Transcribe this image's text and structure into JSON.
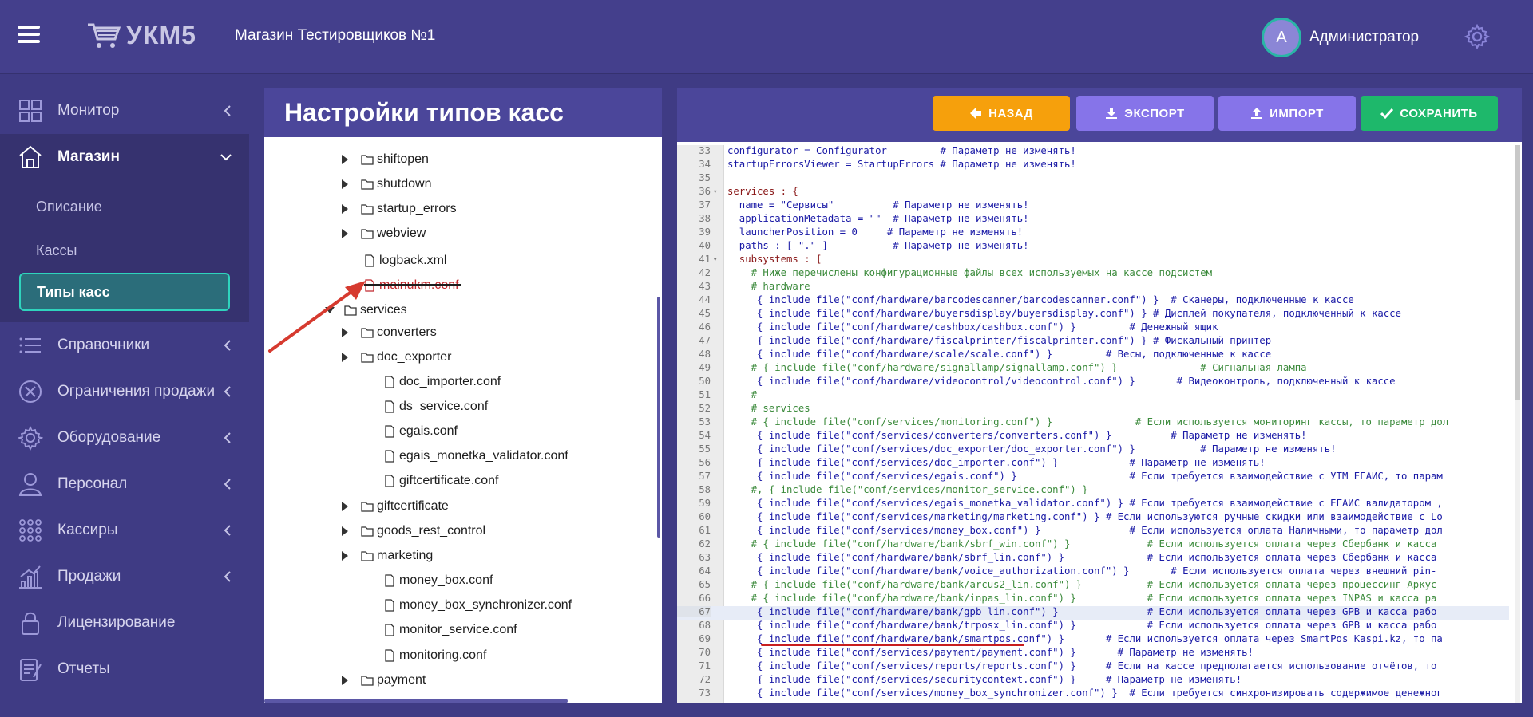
{
  "header": {
    "logo_text": "УКМ5",
    "store_name": "Магазин Тестировщиков №1",
    "user_initial": "А",
    "user_name": "Администратор"
  },
  "sidebar": {
    "items": [
      {
        "label": "Монитор",
        "icon": "grid-icon"
      },
      {
        "label": "Магазин",
        "icon": "store-icon",
        "open": true
      },
      {
        "label": "Справочники",
        "icon": "list-icon"
      },
      {
        "label": "Ограничения продажи",
        "icon": "x-circle-icon"
      },
      {
        "label": "Оборудование",
        "icon": "gear-icon"
      },
      {
        "label": "Персонал",
        "icon": "user-icon"
      },
      {
        "label": "Кассиры",
        "icon": "dots-grid-icon"
      },
      {
        "label": "Продажи",
        "icon": "chart-icon"
      },
      {
        "label": "Лицензирование",
        "icon": "lock-icon"
      },
      {
        "label": "Отчеты",
        "icon": "report-icon"
      }
    ],
    "submenu": [
      {
        "label": "Описание"
      },
      {
        "label": "Кассы"
      },
      {
        "label": "Типы касс",
        "active": true
      }
    ]
  },
  "tree_panel": {
    "title": "Настройки типов касс",
    "rows": [
      {
        "label": "shiftopen",
        "kind": "folder",
        "arrow": true
      },
      {
        "label": "shutdown",
        "kind": "folder",
        "arrow": true
      },
      {
        "label": "startup_errors",
        "kind": "folder",
        "arrow": true
      },
      {
        "label": "webview",
        "kind": "folder",
        "arrow": true
      },
      {
        "label": "logback.xml",
        "kind": "file",
        "arrow": false
      },
      {
        "label": "mainukm.conf",
        "kind": "file",
        "arrow": false,
        "error": true
      },
      {
        "label": "services",
        "kind": "folder",
        "arrow": true,
        "expanded": true
      },
      {
        "label": "converters",
        "kind": "folder",
        "arrow": true
      },
      {
        "label": "doc_exporter",
        "kind": "folder",
        "arrow": true
      },
      {
        "label": "doc_importer.conf",
        "kind": "file",
        "arrow": false
      },
      {
        "label": "ds_service.conf",
        "kind": "file",
        "arrow": false
      },
      {
        "label": "egais.conf",
        "kind": "file",
        "arrow": false
      },
      {
        "label": "egais_monetka_validator.conf",
        "kind": "file",
        "arrow": false
      },
      {
        "label": "giftcertificate.conf",
        "kind": "file",
        "arrow": false
      },
      {
        "label": "giftcertificate",
        "kind": "folder",
        "arrow": true
      },
      {
        "label": "goods_rest_control",
        "kind": "folder",
        "arrow": true
      },
      {
        "label": "marketing",
        "kind": "folder",
        "arrow": true
      },
      {
        "label": "money_box.conf",
        "kind": "file",
        "arrow": false
      },
      {
        "label": "money_box_synchronizer.conf",
        "kind": "file",
        "arrow": false
      },
      {
        "label": "monitor_service.conf",
        "kind": "file",
        "arrow": false
      },
      {
        "label": "monitoring.conf",
        "kind": "file",
        "arrow": false
      },
      {
        "label": "payment",
        "kind": "folder",
        "arrow": true
      }
    ]
  },
  "toolbar": {
    "back_label": "НАЗАД",
    "export_label": "ЭКСПОРТ",
    "import_label": "ИМПОРТ",
    "save_label": "СОХРАНИТЬ"
  },
  "editor": {
    "lines": [
      {
        "n": "33",
        "t": "configurator = Configurator         # Параметр не изменять!"
      },
      {
        "n": "34",
        "t": "startupErrorsViewer = StartupErrors # Параметр не изменять!"
      },
      {
        "n": "35",
        "t": ""
      },
      {
        "n": "36",
        "t": "services : {",
        "fold": true
      },
      {
        "n": "37",
        "t": "  name = \"Сервисы\"          # Параметр не изменять!"
      },
      {
        "n": "38",
        "t": "  applicationMetadata = \"\"  # Параметр не изменять!"
      },
      {
        "n": "39",
        "t": "  launcherPosition = 0     # Параметр не изменять!"
      },
      {
        "n": "40",
        "t": "  paths : [ \".\" ]           # Параметр не изменять!"
      },
      {
        "n": "41",
        "t": "  subsystems : [",
        "fold": true
      },
      {
        "n": "42",
        "t": "    # Ниже перечислены конфигурационные файлы всех используемых на кассе подсистем"
      },
      {
        "n": "43",
        "t": "    # hardware"
      },
      {
        "n": "44",
        "t": "     { include file(\"conf/hardware/barcodescanner/barcodescanner.conf\") }  # Сканеры, подключенные к кассе"
      },
      {
        "n": "45",
        "t": "     { include file(\"conf/hardware/buyersdisplay/buyersdisplay.conf\") } # Дисплей покупателя, подключенный к кассе"
      },
      {
        "n": "46",
        "t": "     { include file(\"conf/hardware/cashbox/cashbox.conf\") }         # Денежный ящик"
      },
      {
        "n": "47",
        "t": "     { include file(\"conf/hardware/fiscalprinter/fiscalprinter.conf\") } # Фискальный принтер"
      },
      {
        "n": "48",
        "t": "     { include file(\"conf/hardware/scale/scale.conf\") }         # Весы, подключенные к кассе"
      },
      {
        "n": "49",
        "t": "    # { include file(\"conf/hardware/signallamp/signallamp.conf\") }              # Сигнальная лампа"
      },
      {
        "n": "50",
        "t": "     { include file(\"conf/hardware/videocontrol/videocontrol.conf\") }       # Видеоконтроль, подключенный к кассе"
      },
      {
        "n": "51",
        "t": "    #"
      },
      {
        "n": "52",
        "t": "    # services"
      },
      {
        "n": "53",
        "t": "    # { include file(\"conf/services/monitoring.conf\") }              # Если используется мониторинг кассы, то параметр дол"
      },
      {
        "n": "54",
        "t": "     { include file(\"conf/services/converters/converters.conf\") }          # Параметр не изменять!"
      },
      {
        "n": "55",
        "t": "     { include file(\"conf/services/doc_exporter/doc_exporter.conf\") }           # Параметр не изменять!"
      },
      {
        "n": "56",
        "t": "     { include file(\"conf/services/doc_importer.conf\") }            # Параметр не изменять!"
      },
      {
        "n": "57",
        "t": "     { include file(\"conf/services/egais.conf\") }                   # Если требуется взаимодействие с УТМ ЕГАИС, то парам"
      },
      {
        "n": "58",
        "t": "    #, { include file(\"conf/services/monitor_service.conf\") }"
      },
      {
        "n": "59",
        "t": "     { include file(\"conf/services/egais_monetka_validator.conf\") } # Если требуется взаимодействие с ЕГАИС валидатором ,"
      },
      {
        "n": "60",
        "t": "     { include file(\"conf/services/marketing/marketing.conf\") } # Если используются ручные скидки или взаимодействие с Lo"
      },
      {
        "n": "61",
        "t": "     { include file(\"conf/services/money_box.conf\") }               # Если используется оплата Наличными, то параметр дол"
      },
      {
        "n": "62",
        "t": "    # { include file(\"conf/hardware/bank/sbrf_win.conf\") }             # Если используется оплата через Сбербанк и касса"
      },
      {
        "n": "63",
        "t": "     { include file(\"conf/hardware/bank/sbrf_lin.conf\") }              # Если используется оплата через Сбербанк и касса"
      },
      {
        "n": "64",
        "t": "     { include file(\"conf/hardware/bank/voice_authorization.conf\") }       # Если используется оплата через внешний pin-"
      },
      {
        "n": "65",
        "t": "    # { include file(\"conf/hardware/bank/arcus2_lin.conf\") }           # Если используется оплата через процессинг Аркус"
      },
      {
        "n": "66",
        "t": "    # { include file(\"conf/hardware/bank/inpas_lin.conf\") }            # Если используется оплата через INPAS и касса ра"
      },
      {
        "n": "67",
        "t": "     { include file(\"conf/hardware/bank/gpb_lin.conf\") }               # Если используется оплата через GPB и касса рабо",
        "hl": true
      },
      {
        "n": "68",
        "t": "     { include file(\"conf/hardware/bank/trposx_lin.conf\") }            # Если используется оплата через GPB и касса рабо"
      },
      {
        "n": "69",
        "t": "     { include file(\"conf/hardware/bank/smartpos.conf\") }       # Если используется оплата через SmartPos Kaspi.kz, то па"
      },
      {
        "n": "70",
        "t": "     { include file(\"conf/services/payment/payment.conf\") }       # Параметр не изменять!"
      },
      {
        "n": "71",
        "t": "     { include file(\"conf/services/reports/reports.conf\") }     # Если на кассе предполагается использование отчётов, то"
      },
      {
        "n": "72",
        "t": "     { include file(\"conf/services/securitycontext.conf\") }     # Параметр не изменять!"
      },
      {
        "n": "73",
        "t": "     { include file(\"conf/services/money_box_synchronizer.conf\") }  # Если требуется синхронизировать содержимое денежног"
      }
    ]
  },
  "colors": {
    "bg": "#3f3b84",
    "panel_header": "#4b469a",
    "back": "#f6a00c",
    "export_import": "#8674e9",
    "save": "#1eb86b",
    "active_sub": "#2b6d7a",
    "active_border": "#2fd4bd",
    "error": "#c1272d"
  }
}
